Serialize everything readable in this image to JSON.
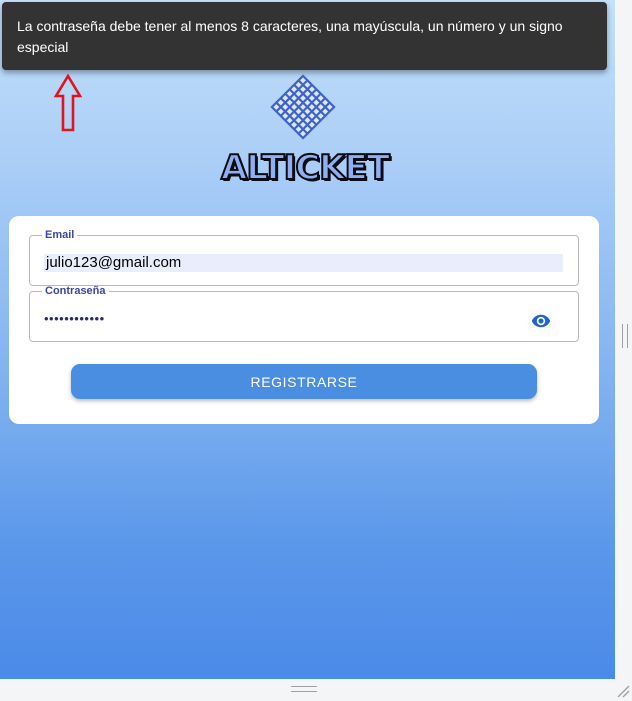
{
  "toast": {
    "message": "La contraseña debe tener al menos 8 caracteres, una mayúscula, un número y un signo especial"
  },
  "annotation": {
    "icon": "arrow-up-icon",
    "color": "#e0141e"
  },
  "brand": {
    "name": "ALTICKET",
    "logo_icon": "lattice-logo-icon",
    "color": "#8fb0f0"
  },
  "form": {
    "email": {
      "label": "Email",
      "value": "julio123@gmail.com"
    },
    "password": {
      "label": "Contraseña",
      "masked_value": "••••••••••••",
      "toggle_icon": "eye-icon"
    },
    "submit_label": "REGISTRARSE"
  },
  "colors": {
    "accent": "#4a8ee2",
    "label": "#3b46a0",
    "toast_bg": "#333333"
  }
}
